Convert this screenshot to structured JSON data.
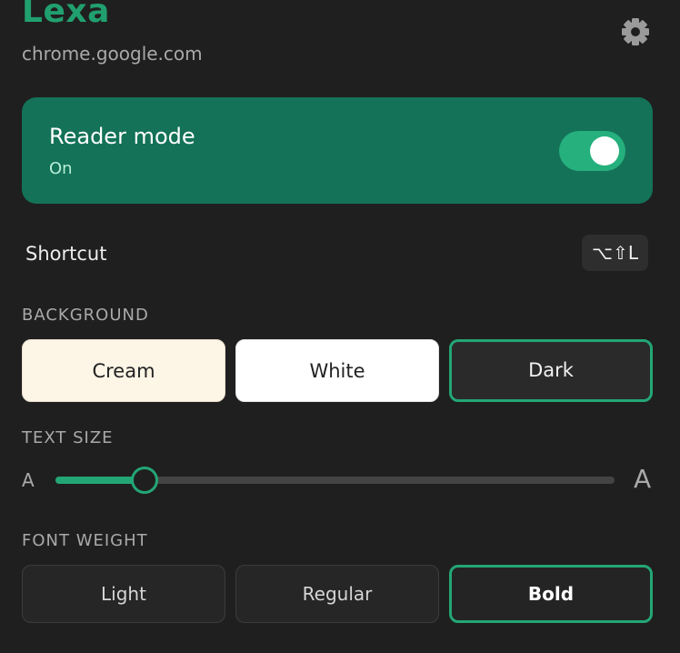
{
  "header": {
    "app_name": "Lexa",
    "site": "chrome.google.com",
    "settings_icon": "gear-icon"
  },
  "reader": {
    "title": "Reader mode",
    "state": "On",
    "enabled": true
  },
  "shortcut": {
    "label": "Shortcut",
    "keys": "⌥⇧L"
  },
  "background": {
    "label": "BACKGROUND",
    "options": [
      "Cream",
      "White",
      "Dark"
    ],
    "selected": "Dark"
  },
  "text_size": {
    "label": "TEXT SIZE",
    "small_glyph": "A",
    "large_glyph": "A",
    "level": 0.16
  },
  "font_weight": {
    "label": "FONT WEIGHT",
    "options": [
      "Light",
      "Regular",
      "Bold"
    ],
    "selected": "Bold"
  },
  "colors": {
    "accent": "#21a06f",
    "card": "#137257",
    "panel": "#1f1f1f"
  }
}
